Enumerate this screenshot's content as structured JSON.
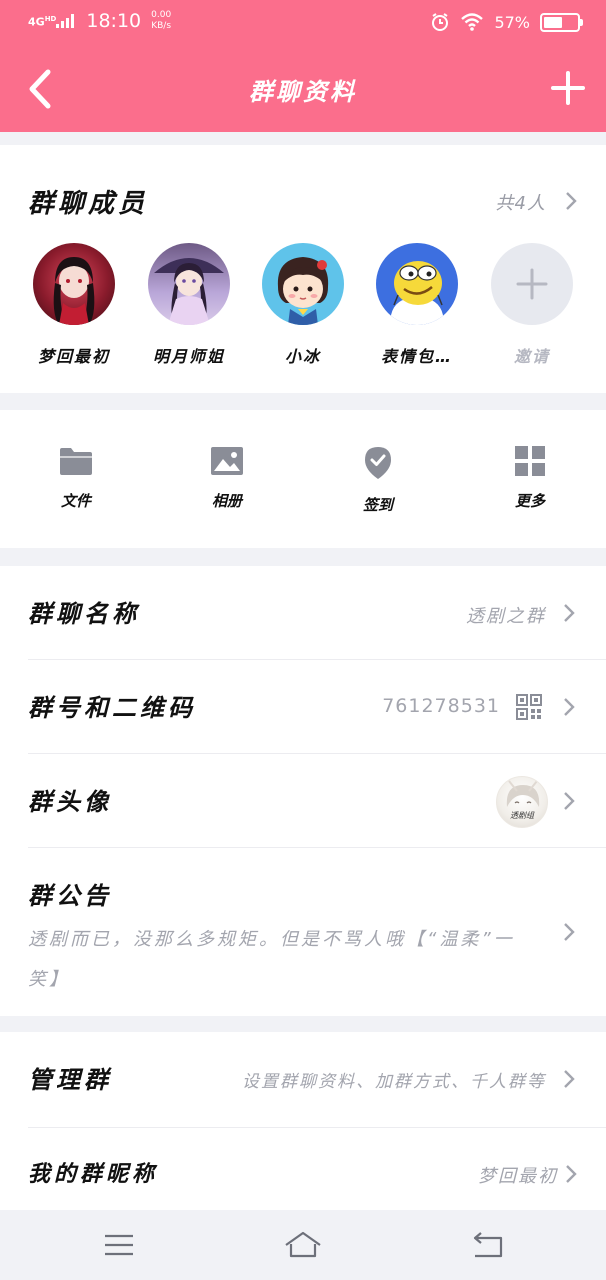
{
  "status_bar": {
    "network": "4G",
    "network_sup": "HD",
    "time": "18:10",
    "speed_value": "0.00",
    "speed_unit": "KB/s",
    "battery": "57%",
    "battery_level": 0.57
  },
  "header": {
    "title": "群聊资料",
    "back_icon": "chevron-left-icon",
    "add_icon": "plus-icon"
  },
  "members": {
    "title": "群聊成员",
    "count": "共4人",
    "items": [
      {
        "name": "梦回最初",
        "avatar": "anime-girl-red-avatar"
      },
      {
        "name": "明月师姐",
        "avatar": "anime-girl-umbrella-avatar"
      },
      {
        "name": "小冰",
        "avatar": "cartoon-girl-avatar"
      },
      {
        "name": "表情包…",
        "avatar": "emoji-face-avatar"
      }
    ],
    "invite_label": "邀请"
  },
  "actions": [
    {
      "label": "文件",
      "icon": "folder-icon"
    },
    {
      "label": "相册",
      "icon": "image-icon"
    },
    {
      "label": "签到",
      "icon": "location-check-icon"
    },
    {
      "label": "更多",
      "icon": "grid-icon"
    }
  ],
  "settings": {
    "group_name_label": "群聊名称",
    "group_name_value": "透剧之群",
    "group_number_label": "群号和二维码",
    "group_number_value": "761278531",
    "group_avatar_label": "群头像",
    "group_avatar_text": "透剧组",
    "notice_label": "群公告",
    "notice_text": "透剧而已，没那么多规矩。但是不骂人哦【“温柔”一笑】",
    "manage_label": "管理群",
    "manage_value": "设置群聊资料、加群方式、千人群等",
    "nickname_label": "我的群昵称",
    "nickname_value": "梦回最初"
  },
  "nav": {
    "menu_icon": "menu-icon",
    "home_icon": "home-icon",
    "back_icon": "back-icon"
  },
  "colors": {
    "accent": "#fb6e8c",
    "background": "#f1f2f6",
    "secondary_text": "#a3a5ae",
    "icon_gray": "#8a8d97"
  }
}
